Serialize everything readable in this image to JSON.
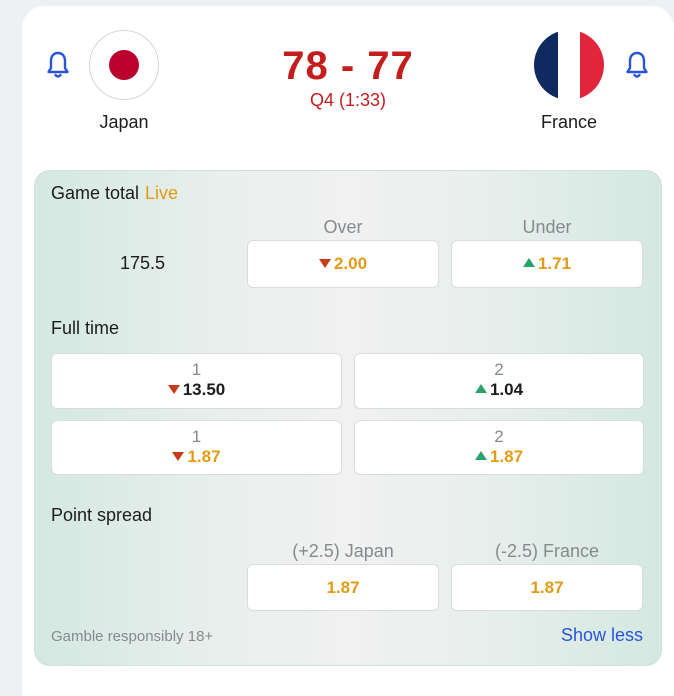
{
  "match": {
    "home_team": "Japan",
    "away_team": "France",
    "score": "78 - 77",
    "period": "Q4 (1:33)"
  },
  "game_total": {
    "title": "Game total",
    "live_label": "Live",
    "line": "175.5",
    "over_label": "Over",
    "under_label": "Under",
    "over_odds": "2.00",
    "under_odds": "1.71",
    "over_trend": "down",
    "under_trend": "up"
  },
  "full_time": {
    "title": "Full time",
    "rows": [
      [
        {
          "label": "1",
          "odds": "13.50",
          "trend": "down"
        },
        {
          "label": "2",
          "odds": "1.04",
          "trend": "up"
        }
      ],
      [
        {
          "label": "1",
          "odds": "1.87",
          "trend": "down"
        },
        {
          "label": "2",
          "odds": "1.87",
          "trend": "up"
        }
      ]
    ]
  },
  "point_spread": {
    "title": "Point spread",
    "home_label": "(+2.5) Japan",
    "away_label": "(-2.5) France",
    "home_odds": "1.87",
    "away_odds": "1.87"
  },
  "footer": {
    "gamble_note": "Gamble responsibly 18+",
    "show_less": "Show less"
  },
  "colors": {
    "score_red": "#c41d1d",
    "odds_orange": "#e39b14",
    "link_blue": "#2a54d8",
    "bell_blue": "#2a54d8",
    "trend_down": "#c73a1c",
    "trend_up": "#2aa26b"
  }
}
